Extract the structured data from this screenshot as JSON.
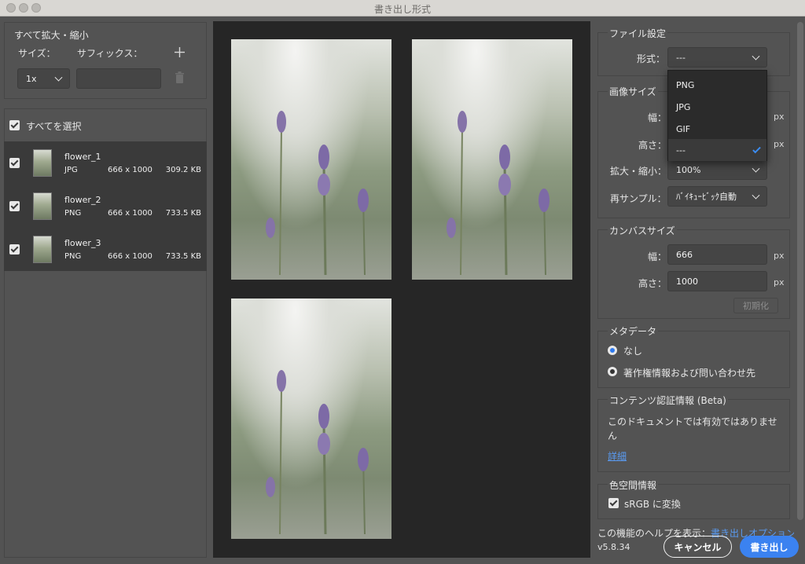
{
  "window": {
    "title": "書き出し形式"
  },
  "scale_all": {
    "title": "すべて拡大・縮小",
    "size_label": "サイズ：",
    "suffix_label": "サフィックス：",
    "scale_value": "1x",
    "suffix_value": ""
  },
  "file_list": {
    "select_all_label": "すべてを選択",
    "files": [
      {
        "name": "flower_1",
        "type": "JPG",
        "dims": "666 x 1000",
        "size": "309.2 KB"
      },
      {
        "name": "flower_2",
        "type": "PNG",
        "dims": "666 x 1000",
        "size": "733.5 KB"
      },
      {
        "name": "flower_3",
        "type": "PNG",
        "dims": "666 x 1000",
        "size": "733.5 KB"
      }
    ]
  },
  "file_settings": {
    "title": "ファイル設定",
    "format_label": "形式：",
    "format_value": "---",
    "format_options": [
      "PNG",
      "JPG",
      "GIF",
      "---"
    ],
    "selected_option": "---"
  },
  "image_size": {
    "title": "画像サイズ",
    "width_label": "幅：",
    "height_label": "高さ：",
    "unit": "px",
    "scale_label": "拡大・縮小：",
    "scale_value": "100%",
    "resample_label": "再サンプル：",
    "resample_value": "ﾊﾞｲｷｭｰﾋﾞｯｸ自動"
  },
  "canvas_size": {
    "title": "カンバスサイズ",
    "width_label": "幅：",
    "width_value": "666",
    "height_label": "高さ：",
    "height_value": "1000",
    "unit": "px",
    "reset_label": "初期化"
  },
  "metadata": {
    "title": "メタデータ",
    "option_none": "なし",
    "option_copyright": "著作権情報および問い合わせ先",
    "selected": "なし"
  },
  "content_credentials": {
    "title": "コンテンツ認証情報 (Beta)",
    "message_line1": "このドキュメントでは有効ではありませ",
    "message_line2": "ん",
    "details_link": "詳細"
  },
  "color_space": {
    "title": "色空間情報",
    "convert_label": "sRGB に変換"
  },
  "footer": {
    "help_prefix": "この機能のヘルプを表示：",
    "help_link": "書き出しオプション",
    "version": "v5.8.34",
    "cancel_label": "キャンセル",
    "export_label": "書き出し"
  },
  "colors": {
    "accent": "#3b82f0",
    "panel": "#535353",
    "preview_bg": "#262626"
  }
}
